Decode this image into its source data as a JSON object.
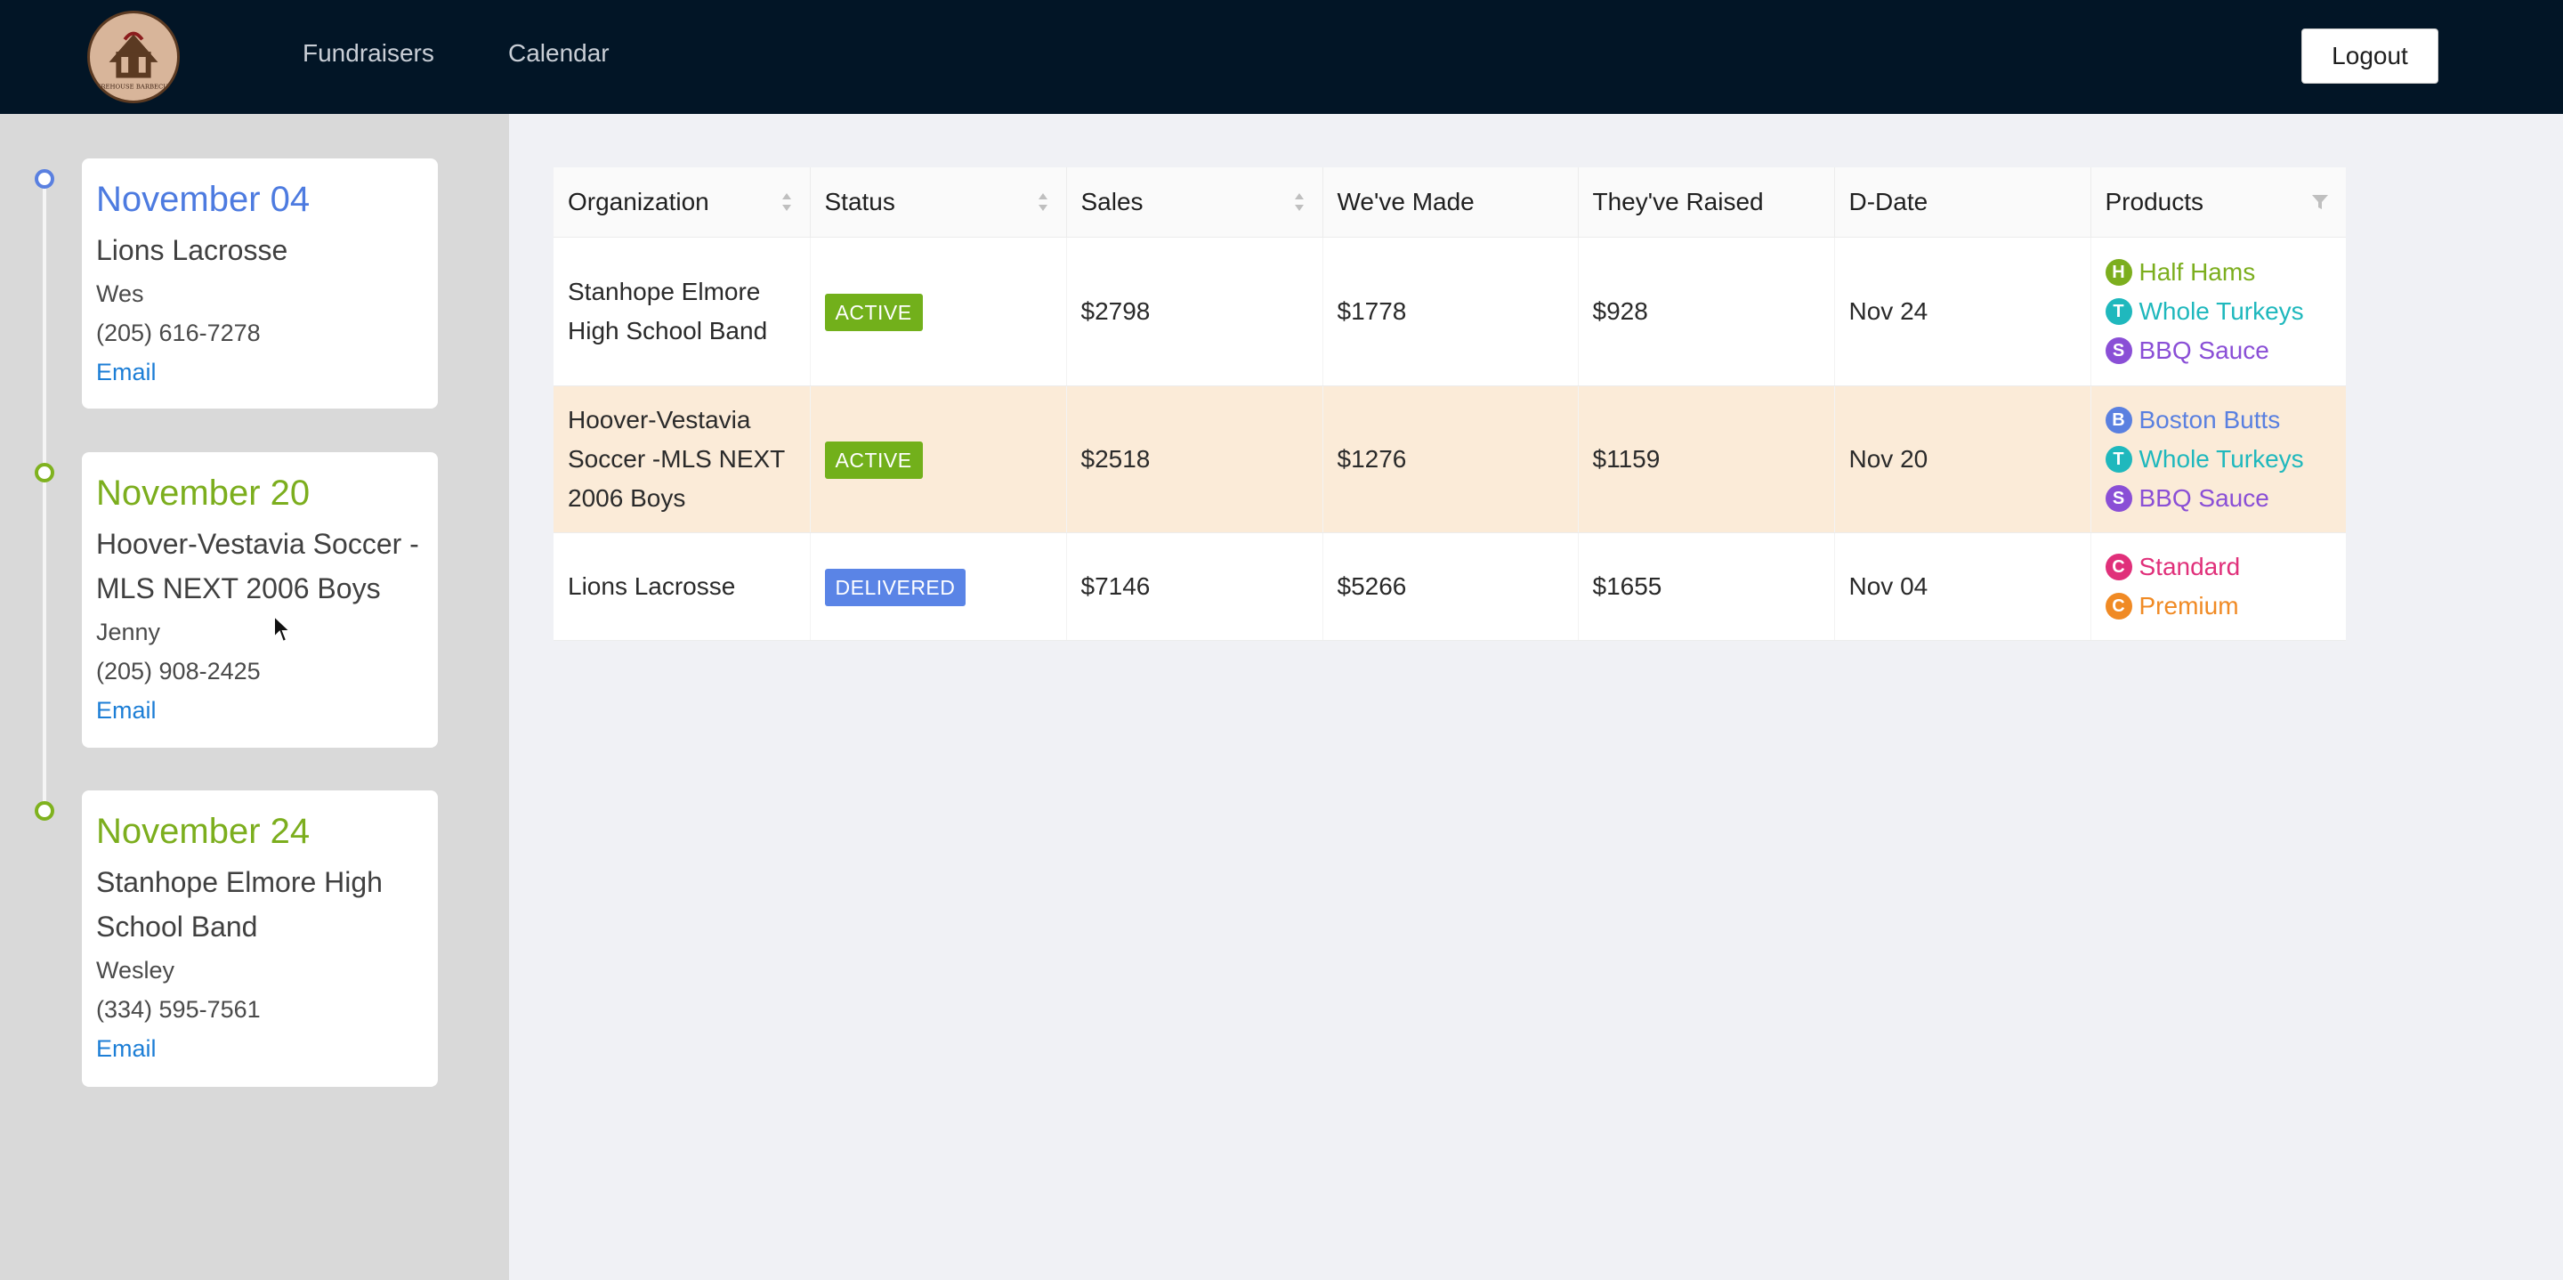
{
  "header": {
    "logo_text": "FIREHOUSE BARBECUE",
    "nav": [
      {
        "label": "Fundraisers"
      },
      {
        "label": "Calendar"
      }
    ],
    "logout_label": "Logout"
  },
  "sidebar": {
    "events": [
      {
        "date": "November 04",
        "org": "Lions Lacrosse",
        "contact": "Wes",
        "phone": "(205) 616-7278",
        "email_label": "Email",
        "color": "#4d7be0"
      },
      {
        "date": "November 20",
        "org": "Hoover-Vestavia Soccer -MLS NEXT 2006 Boys",
        "contact": "Jenny",
        "phone": "(205) 908-2425",
        "email_label": "Email",
        "color": "#7cae1e"
      },
      {
        "date": "November 24",
        "org": "Stanhope Elmore High School Band",
        "contact": "Wesley",
        "phone": "(334) 595-7561",
        "email_label": "Email",
        "color": "#7cae1e"
      }
    ]
  },
  "table": {
    "columns": [
      "Organization",
      "Status",
      "Sales",
      "We've Made",
      "They've Raised",
      "D-Date",
      "Products"
    ],
    "rows": [
      {
        "organization": "Stanhope Elmore High School Band",
        "status": "ACTIVE",
        "sales": "$2798",
        "made": "$1778",
        "raised": "$928",
        "ddate": "Nov 24",
        "products": [
          {
            "letter": "H",
            "name": "Half Hams",
            "color": "#7cae1e"
          },
          {
            "letter": "T",
            "name": "Whole Turkeys",
            "color": "#1fb8bd"
          },
          {
            "letter": "S",
            "name": "BBQ Sauce",
            "color": "#8a4fd6"
          }
        ]
      },
      {
        "organization": "Hoover-Vestavia Soccer -MLS NEXT 2006 Boys",
        "status": "ACTIVE",
        "sales": "$2518",
        "made": "$1276",
        "raised": "$1159",
        "ddate": "Nov 20",
        "products": [
          {
            "letter": "B",
            "name": "Boston Butts",
            "color": "#5a80e0"
          },
          {
            "letter": "T",
            "name": "Whole Turkeys",
            "color": "#1fb8bd"
          },
          {
            "letter": "S",
            "name": "BBQ Sauce",
            "color": "#8a4fd6"
          }
        ]
      },
      {
        "organization": "Lions Lacrosse",
        "status": "DELIVERED",
        "sales": "$7146",
        "made": "$5266",
        "raised": "$1655",
        "ddate": "Nov 04",
        "products": [
          {
            "letter": "C",
            "name": "Standard",
            "color": "#e0307a"
          },
          {
            "letter": "C",
            "name": "Premium",
            "color": "#f08a24"
          }
        ]
      }
    ]
  }
}
